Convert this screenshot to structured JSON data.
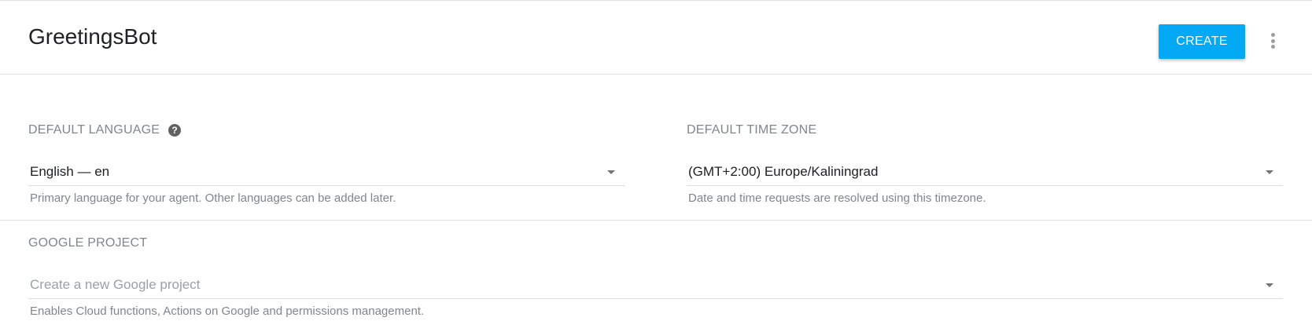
{
  "agent": {
    "name": "GreetingsBot"
  },
  "toolbar": {
    "create_label": "CREATE",
    "more_icon": "more-vert-icon"
  },
  "language": {
    "label": "DEFAULT LANGUAGE",
    "help_icon": "help-icon",
    "value": "English — en",
    "hint": "Primary language for your agent. Other languages can be added later."
  },
  "timezone": {
    "label": "DEFAULT TIME ZONE",
    "value": "(GMT+2:00) Europe/Kaliningrad",
    "hint": "Date and time requests are resolved using this timezone."
  },
  "google_project": {
    "label": "GOOGLE PROJECT",
    "placeholder": "Create a new Google project",
    "hint": "Enables Cloud functions, Actions on Google and permissions management."
  },
  "colors": {
    "accent": "#03a9f4",
    "label": "#80868b",
    "text": "#202124"
  }
}
